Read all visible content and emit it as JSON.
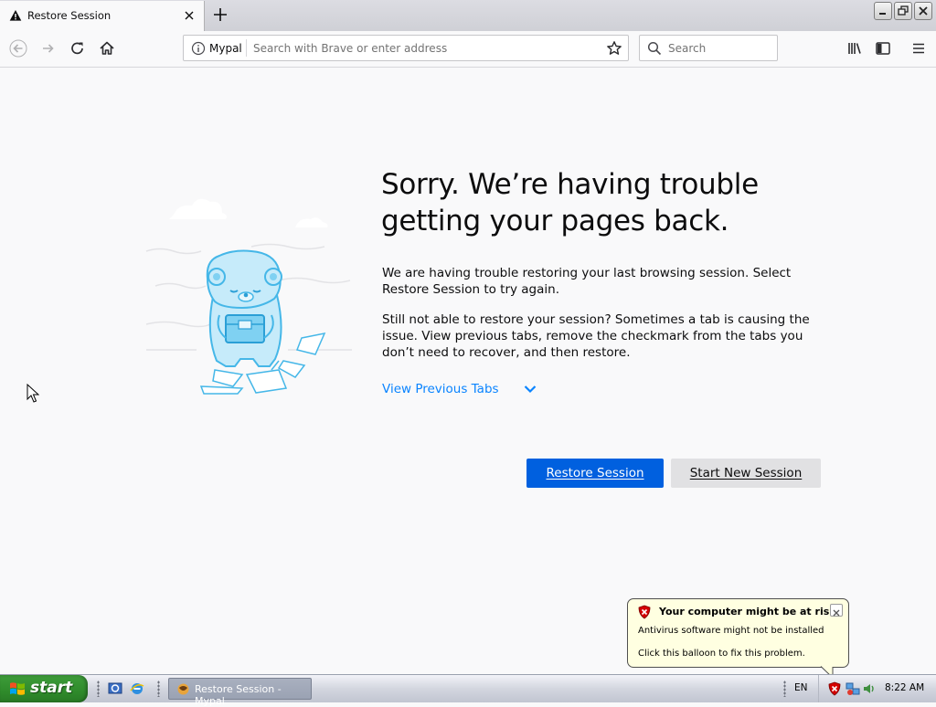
{
  "tab": {
    "title": "Restore Session"
  },
  "toolbar": {
    "site_identity": "Mypal",
    "url_placeholder": "Search with Brave or enter address",
    "search_placeholder": "Search"
  },
  "content": {
    "heading_line1": "Sorry. We’re having trouble",
    "heading_line2": "getting your pages back.",
    "paragraph1": "We are having trouble restoring your last browsing session. Select Restore Session to try again.",
    "paragraph2": "Still not able to restore your session? Sometimes a tab is causing the issue. View previous tabs, remove the checkmark from the tabs you don’t need to recover, and then restore.",
    "view_previous_tabs": "View Previous Tabs",
    "restore_button": "Restore Session",
    "new_session_button": "Start New Session"
  },
  "balloon": {
    "title": "Your computer might be at risk",
    "line1": "Antivirus software might not be installed",
    "line2": "Click this balloon to fix this problem."
  },
  "taskbar": {
    "start_label": "start",
    "task_label": "Restore Session - Mypal",
    "language": "EN",
    "clock": "8:22 AM"
  },
  "colors": {
    "primary_button": "#0060df",
    "link": "#0a84ff",
    "page_background": "#f9f9fa",
    "balloon_background": "#ffffe1",
    "start_green": "#2f8b2b"
  },
  "icons": [
    "warning-icon",
    "close-icon",
    "new-tab-icon",
    "back-icon",
    "forward-icon",
    "reload-icon",
    "home-icon",
    "info-icon",
    "bookmark-star-icon",
    "search-icon",
    "library-icon",
    "sidebar-icon",
    "menu-icon",
    "chevron-down-icon",
    "shield-icon",
    "windows-flag-icon",
    "ie-icon"
  ]
}
